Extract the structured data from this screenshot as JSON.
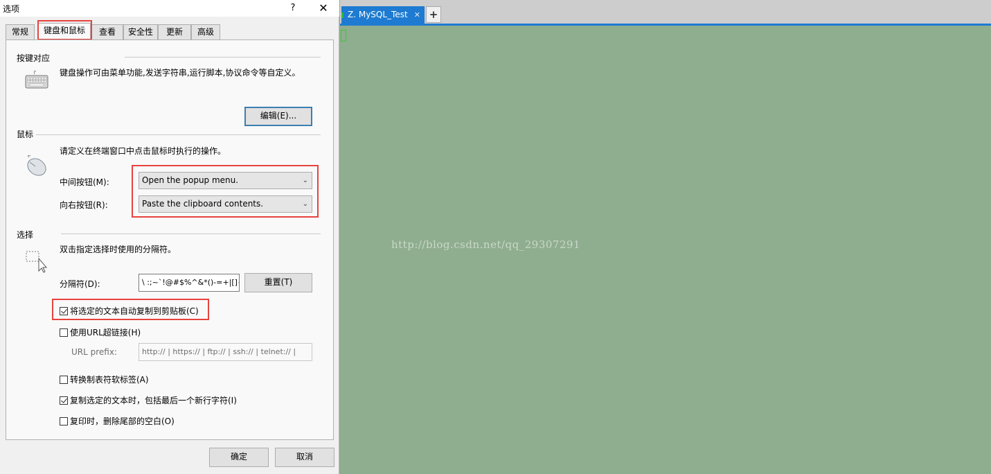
{
  "dialog": {
    "title": "选项",
    "help_label": "?",
    "close_label": "✕",
    "tabs": [
      {
        "label": "常规"
      },
      {
        "label": "键盘和鼠标"
      },
      {
        "label": "查看"
      },
      {
        "label": "安全性"
      },
      {
        "label": "更新"
      },
      {
        "label": "高级"
      }
    ],
    "active_tab": "键盘和鼠标",
    "keyboard": {
      "title": "按键对应",
      "description": "键盘操作可由菜单功能,发送字符串,运行脚本,协议命令等自定义。",
      "edit_button": "编辑(E)...",
      "icon": "keyboard-icon"
    },
    "mouse": {
      "title": "鼠标",
      "description": "请定义在终端窗口中点击鼠标时执行的操作。",
      "icon": "mouse-icon",
      "middle_label": "中间按钮(M):",
      "middle_value": "Open the popup menu.",
      "right_label": "向右按钮(R):",
      "right_value": "Paste the clipboard contents."
    },
    "selection": {
      "title": "选择",
      "description": "双击指定选择时使用的分隔符。",
      "icon": "selection-cursor-icon",
      "delimiter_label": "分隔符(D):",
      "delimiter_value": "\\ :;~`!@#$%^&*()-=+|[]{}",
      "reset_button": "重置(T)",
      "auto_copy": {
        "label": "将选定的文本自动复制到剪贴板(C)",
        "checked": true
      },
      "url_hyperlink": {
        "label": "使用URL超链接(H)",
        "checked": false
      },
      "url_prefix_label": "URL prefix:",
      "url_prefix_value": "http:// | https:// | ftp:// | ssh:// | telnet:// |",
      "convert_tabs": {
        "label": "转换制表符软标签(A)",
        "checked": false
      },
      "copy_newline": {
        "label": "复制选定的文本时，包括最后一个新行字符(I)",
        "checked": true
      },
      "trim_trailing": {
        "label": "复印时，删除尾部的空白(O)",
        "checked": false
      }
    },
    "ok_button": "确定",
    "cancel_button": "取消"
  },
  "terminal": {
    "tab_label": "Z. MySQL_Test",
    "tab_close": "✕",
    "new_tab_label": "+",
    "watermark": "http://blog.csdn.net/qq_29307291"
  },
  "colors": {
    "accent": "#1e7bd1",
    "terminal_bg": "#8fad8f",
    "highlight_red": "#e8423e"
  }
}
